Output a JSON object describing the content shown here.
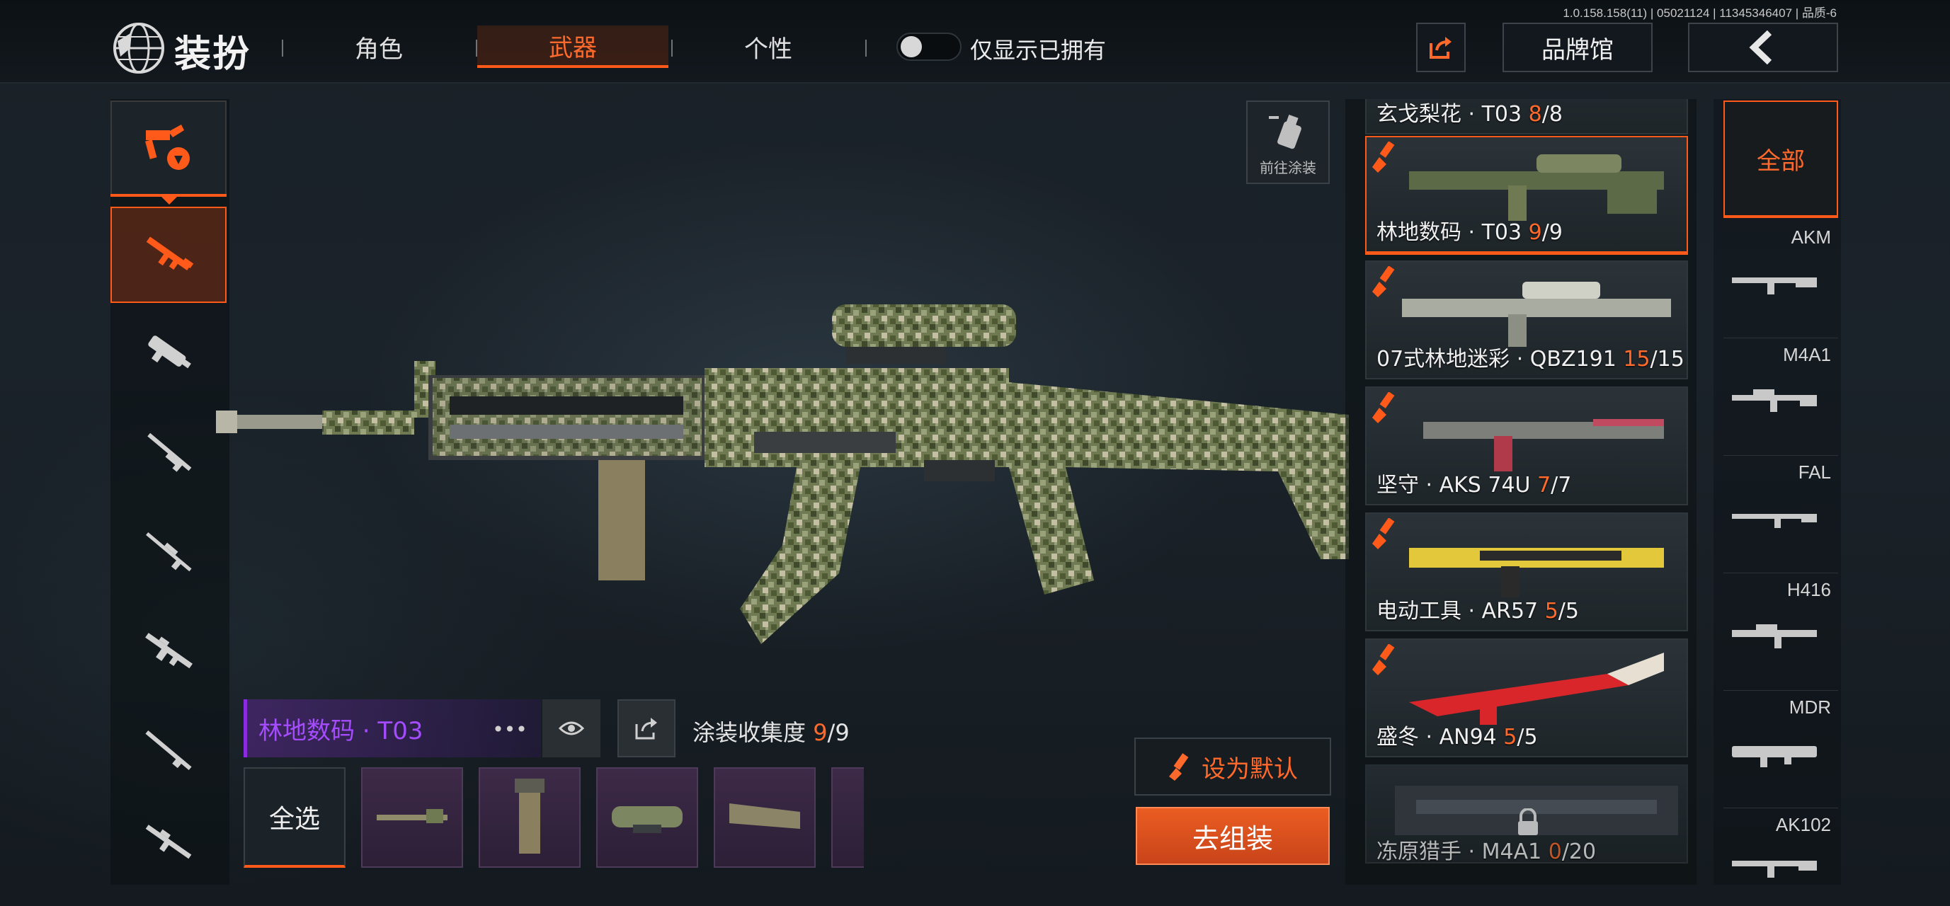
{
  "version": "1.0.158.158(11) | 05021124 | 11345346407 | 品质-6",
  "header": {
    "title": "装扮",
    "tabs": [
      {
        "label": "角色"
      },
      {
        "label": "武器"
      },
      {
        "label": "个性"
      }
    ],
    "owned_toggle_label": "仅显示已拥有",
    "brand_button": "品牌馆"
  },
  "sidebar": {
    "items": [
      {
        "icon": "skin-brush-icon"
      },
      {
        "icon": "assault-rifle-icon"
      },
      {
        "icon": "smg-icon"
      },
      {
        "icon": "shotgun-icon"
      },
      {
        "icon": "sniper-rifle-icon"
      },
      {
        "icon": "machine-gun-icon"
      },
      {
        "icon": "marksman-rifle-icon"
      },
      {
        "icon": "rifle-icon"
      }
    ]
  },
  "goto_paint": "前往涂装",
  "selected_skin": {
    "name": "林地数码 · T03",
    "collect_label": "涂装收集度",
    "collect_have": "9",
    "collect_total": "/9"
  },
  "parts": {
    "select_all": "全选",
    "items": [
      {
        "icon": "barrel-part-icon"
      },
      {
        "icon": "grip-part-icon"
      },
      {
        "icon": "scope-part-icon"
      },
      {
        "icon": "stock-part-icon"
      }
    ]
  },
  "actions": {
    "set_default": "设为默认",
    "assemble": "去组装"
  },
  "skin_list": [
    {
      "name": "玄戈梨花 · T03 ",
      "have": "8",
      "total": "/8"
    },
    {
      "name": "林地数码 · T03 ",
      "have": "9",
      "total": "/9"
    },
    {
      "name": "07式林地迷彩 · QBZ191 ",
      "have": "15",
      "total": "/15"
    },
    {
      "name": "坚守 · AKS 74U ",
      "have": "7",
      "total": "/7"
    },
    {
      "name": "电动工具 · AR57 ",
      "have": "5",
      "total": "/5"
    },
    {
      "name": "盛冬 · AN94 ",
      "have": "5",
      "total": "/5"
    },
    {
      "name": "冻原猎手 · M4A1 ",
      "have": "0",
      "total": "/20"
    }
  ],
  "weapon_filter": {
    "all_label": "全部",
    "items": [
      {
        "name": "AKM"
      },
      {
        "name": "M4A1"
      },
      {
        "name": "FAL"
      },
      {
        "name": "H416"
      },
      {
        "name": "MDR"
      },
      {
        "name": "AK102"
      }
    ]
  },
  "colors": {
    "accent": "#ff5a1a",
    "rare_purple": "#a54cff",
    "background": "#1a2128"
  }
}
